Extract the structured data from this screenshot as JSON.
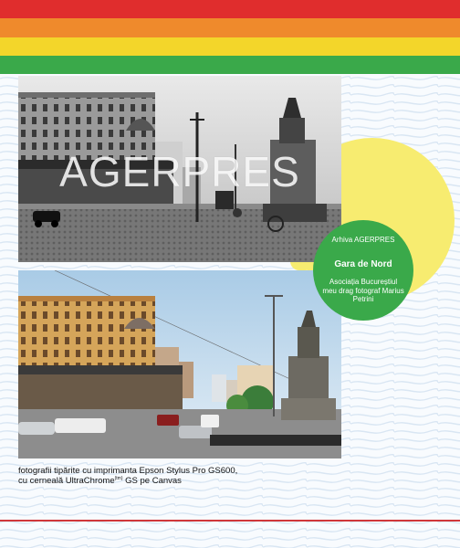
{
  "colors": {
    "stripe_red": "#e02d2d",
    "stripe_orange": "#ef8a2c",
    "stripe_yellow": "#f3d62a",
    "stripe_green": "#3aa94a",
    "circle_green": "#3aa94a",
    "circle_yellow": "#f7ec70",
    "rule_red": "#d0373a"
  },
  "photo_old": {
    "watermark": "AGERPRES"
  },
  "badge": {
    "archive": "Arhiva AGERPRES",
    "title": "Gara de Nord",
    "credit": "Asociația Bucureștiul meu drag fotograf Marius Petrini"
  },
  "caption": {
    "line1": "fotografii tipărite cu imprimanta Epson Stylus Pro GS600,",
    "line2_before": "cu cerneală UltraChrome",
    "superscript": "(tm)",
    "line2_after": " GS pe Canvas"
  }
}
